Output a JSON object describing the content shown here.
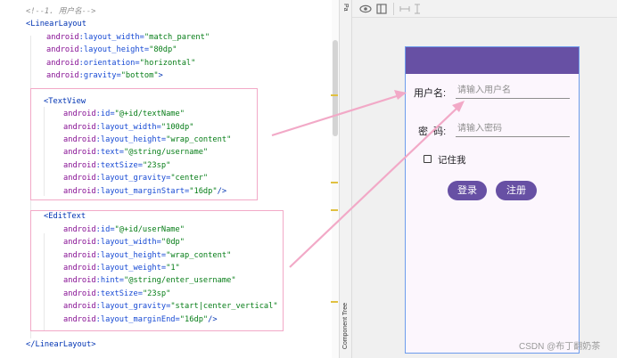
{
  "editor": {
    "lines": [
      [
        {
          "t": "<!--1. 用户名-->",
          "c": "comment"
        }
      ],
      [
        {
          "t": "<",
          "c": "tag"
        },
        {
          "t": "LinearLayout",
          "c": "tag"
        }
      ],
      [
        {
          "t": "android",
          "c": "ns"
        },
        {
          "t": ":layout_width=",
          "c": "attr"
        },
        {
          "t": "\"match_parent\"",
          "c": "str"
        }
      ],
      [
        {
          "t": "android",
          "c": "ns"
        },
        {
          "t": ":layout_height=",
          "c": "attr"
        },
        {
          "t": "\"80dp\"",
          "c": "str"
        }
      ],
      [
        {
          "t": "android",
          "c": "ns"
        },
        {
          "t": ":orientation=",
          "c": "attr"
        },
        {
          "t": "\"horizontal\"",
          "c": "str"
        }
      ],
      [
        {
          "t": "android",
          "c": "ns"
        },
        {
          "t": ":gravity=",
          "c": "attr"
        },
        {
          "t": "\"bottom\"",
          "c": "str"
        },
        {
          "t": ">",
          "c": "tag"
        }
      ],
      [],
      [
        {
          "t": "<",
          "c": "tag"
        },
        {
          "t": "TextView",
          "c": "tag"
        }
      ],
      [
        {
          "t": "android",
          "c": "ns"
        },
        {
          "t": ":id=",
          "c": "attr"
        },
        {
          "t": "\"@+id/textName\"",
          "c": "str"
        }
      ],
      [
        {
          "t": "android",
          "c": "ns"
        },
        {
          "t": ":layout_width=",
          "c": "attr"
        },
        {
          "t": "\"100dp\"",
          "c": "str"
        }
      ],
      [
        {
          "t": "android",
          "c": "ns"
        },
        {
          "t": ":layout_height=",
          "c": "attr"
        },
        {
          "t": "\"wrap_content\"",
          "c": "str"
        }
      ],
      [
        {
          "t": "android",
          "c": "ns"
        },
        {
          "t": ":text=",
          "c": "attr"
        },
        {
          "t": "\"@string/username\"",
          "c": "str"
        }
      ],
      [
        {
          "t": "android",
          "c": "ns"
        },
        {
          "t": ":textSize=",
          "c": "attr"
        },
        {
          "t": "\"23sp\"",
          "c": "str"
        }
      ],
      [
        {
          "t": "android",
          "c": "ns"
        },
        {
          "t": ":layout_gravity=",
          "c": "attr"
        },
        {
          "t": "\"center\"",
          "c": "str"
        }
      ],
      [
        {
          "t": "android",
          "c": "ns"
        },
        {
          "t": ":layout_marginStart=",
          "c": "attr"
        },
        {
          "t": "\"16dp\"",
          "c": "str"
        },
        {
          "t": "/>",
          "c": "tag"
        }
      ],
      [],
      [
        {
          "t": "<",
          "c": "tag"
        },
        {
          "t": "EditText",
          "c": "tag"
        }
      ],
      [
        {
          "t": "android",
          "c": "ns"
        },
        {
          "t": ":id=",
          "c": "attr"
        },
        {
          "t": "\"@+id/userName\"",
          "c": "str"
        }
      ],
      [
        {
          "t": "android",
          "c": "ns"
        },
        {
          "t": ":layout_width=",
          "c": "attr"
        },
        {
          "t": "\"0dp\"",
          "c": "str"
        }
      ],
      [
        {
          "t": "android",
          "c": "ns"
        },
        {
          "t": ":layout_height=",
          "c": "attr"
        },
        {
          "t": "\"wrap_content\"",
          "c": "str"
        }
      ],
      [
        {
          "t": "android",
          "c": "ns"
        },
        {
          "t": ":layout_weight=",
          "c": "attr"
        },
        {
          "t": "\"1\"",
          "c": "str"
        }
      ],
      [
        {
          "t": "android",
          "c": "ns"
        },
        {
          "t": ":hint=",
          "c": "attr"
        },
        {
          "t": "\"@string/enter_username\"",
          "c": "str"
        }
      ],
      [
        {
          "t": "android",
          "c": "ns"
        },
        {
          "t": ":textSize=",
          "c": "attr"
        },
        {
          "t": "\"23sp\"",
          "c": "str"
        }
      ],
      [
        {
          "t": "android",
          "c": "ns"
        },
        {
          "t": ":layout_gravity=",
          "c": "attr"
        },
        {
          "t": "\"start|center_vertical\"",
          "c": "str"
        }
      ],
      [
        {
          "t": "android",
          "c": "ns"
        },
        {
          "t": ":layout_marginEnd=",
          "c": "attr"
        },
        {
          "t": "\"16dp\"",
          "c": "str"
        },
        {
          "t": "/>",
          "c": "tag"
        }
      ],
      [],
      [
        {
          "t": "</",
          "c": "tag"
        },
        {
          "t": "LinearLayout",
          "c": "tag"
        },
        {
          "t": ">",
          "c": "tag"
        }
      ]
    ]
  },
  "side_panel": {
    "top_tab": "Pa",
    "bottom_tab": "Component Tree"
  },
  "preview": {
    "username_label": "用户名:",
    "username_hint": "请输入用户名",
    "password_label": "密  码:",
    "password_hint": "请输入密码",
    "remember_label": "记住我",
    "remember_checked": false,
    "login_button": "登录",
    "register_button": "注册",
    "appbar_color": "#6750a4",
    "button_color": "#6750a4"
  },
  "toolbar_icons": [
    "eye-icon",
    "split-view-icon",
    "horizontal-resize-icon",
    "vertical-resize-icon"
  ],
  "watermark": "CSDN @布丁翻奶茶",
  "annotation_color": "#f2a9c7"
}
